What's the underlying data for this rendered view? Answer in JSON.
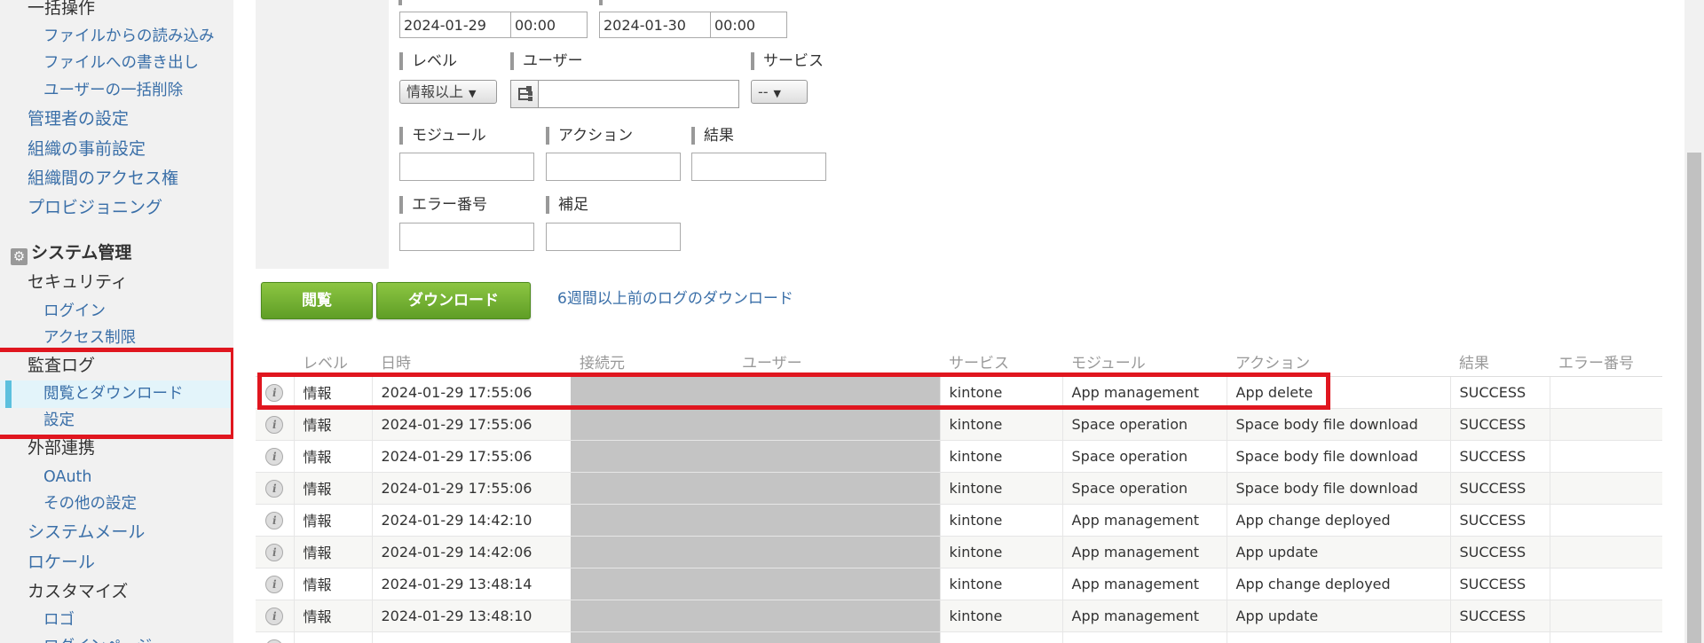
{
  "sidebar": {
    "bulk_ops": "一括操作",
    "bulk_import": "ファイルからの読み込み",
    "bulk_export": "ファイルへの書き出し",
    "bulk_delete": "ユーザーの一括削除",
    "admin_settings": "管理者の設定",
    "org_presettings": "組織の事前設定",
    "org_access": "組織間のアクセス権",
    "provisioning": "プロビジョニング",
    "system_admin": "システム管理",
    "security": "セキュリティ",
    "login": "ログイン",
    "access_limit": "アクセス制限",
    "audit_log": "監査ログ",
    "view_download": "閲覧とダウンロード",
    "settings": "設定",
    "external": "外部連携",
    "oauth": "OAuth",
    "other_settings": "その他の設定",
    "system_mail": "システムメール",
    "locale": "ロケール",
    "customize": "カスタマイズ",
    "logo": "ロゴ",
    "login_page": "ログインページ"
  },
  "filters": {
    "from_date": "2024-01-29",
    "from_time": "00:00",
    "to_date": "2024-01-30",
    "to_time": "00:00",
    "level_label": "レベル",
    "level_value": "情報以上",
    "user_label": "ユーザー",
    "user_value": "",
    "service_label": "サービス",
    "service_value": "--",
    "module_label": "モジュール",
    "action_label": "アクション",
    "result_label": "結果",
    "error_label": "エラー番号",
    "note_label": "補足"
  },
  "actions": {
    "view_button": "閲覧",
    "download_button": "ダウンロード",
    "old_logs_link": "6週間以上前のログのダウンロード"
  },
  "table": {
    "headers": [
      "",
      "レベル",
      "日時",
      "接続元",
      "ユーザー",
      "サービス",
      "モジュール",
      "アクション",
      "結果",
      "エラー番号"
    ],
    "rows": [
      {
        "level": "情報",
        "datetime": "2024-01-29 17:55:06",
        "service": "kintone",
        "module": "App management",
        "action": "App delete",
        "result": "SUCCESS",
        "error": ""
      },
      {
        "level": "情報",
        "datetime": "2024-01-29 17:55:06",
        "service": "kintone",
        "module": "Space operation",
        "action": "Space body file download",
        "result": "SUCCESS",
        "error": ""
      },
      {
        "level": "情報",
        "datetime": "2024-01-29 17:55:06",
        "service": "kintone",
        "module": "Space operation",
        "action": "Space body file download",
        "result": "SUCCESS",
        "error": ""
      },
      {
        "level": "情報",
        "datetime": "2024-01-29 17:55:06",
        "service": "kintone",
        "module": "Space operation",
        "action": "Space body file download",
        "result": "SUCCESS",
        "error": ""
      },
      {
        "level": "情報",
        "datetime": "2024-01-29 14:42:10",
        "service": "kintone",
        "module": "App management",
        "action": "App change deployed",
        "result": "SUCCESS",
        "error": ""
      },
      {
        "level": "情報",
        "datetime": "2024-01-29 14:42:06",
        "service": "kintone",
        "module": "App management",
        "action": "App update",
        "result": "SUCCESS",
        "error": ""
      },
      {
        "level": "情報",
        "datetime": "2024-01-29 13:48:14",
        "service": "kintone",
        "module": "App management",
        "action": "App change deployed",
        "result": "SUCCESS",
        "error": ""
      },
      {
        "level": "情報",
        "datetime": "2024-01-29 13:48:10",
        "service": "kintone",
        "module": "App management",
        "action": "App update",
        "result": "SUCCESS",
        "error": ""
      }
    ]
  },
  "colors": {
    "highlight": "#e0161f",
    "link": "#3a6fa8",
    "button_green": "#6aaa2c",
    "active_bar": "#5bc0de"
  }
}
